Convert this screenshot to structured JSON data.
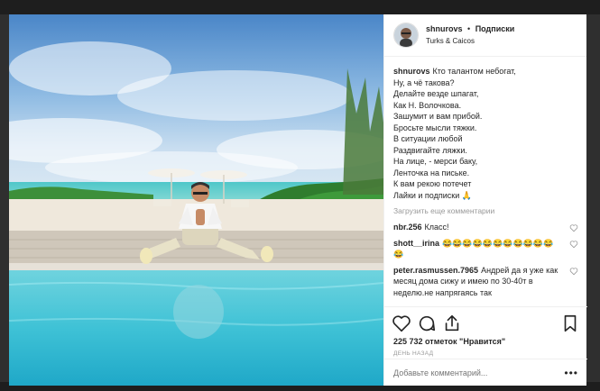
{
  "post": {
    "username": "shnurovs",
    "separator": "•",
    "follow_label": "Подписки",
    "location": "Turks & Caicos"
  },
  "caption": {
    "username": "shnurovs",
    "lines": [
      "Кто талантом небогат,",
      "Ну, а чё такова?",
      "Делайте везде шпагат,",
      "Как Н. Волочкова.",
      "Зашумит и вам прибой.",
      "Бросьте мысли тяжки.",
      "В ситуации любой",
      "Раздвигайте ляжки.",
      "На лице, - мерси баку,",
      "Ленточка на письке.",
      "К вам рекою потечет",
      "Лайки и подписки 🙏"
    ]
  },
  "load_more_label": "Загрузить еще комментарии",
  "comments": [
    {
      "username": "nbr.256",
      "text": "Класс!"
    },
    {
      "username": "shott__irina",
      "text": "😂😂😂😂😂😂😂😂😂😂😂😂"
    },
    {
      "username": "peter.rasmussen.7965",
      "text": "Андрей да я уже как месяц дома сижу и имею по 30-40т в неделю.не напрягаясь так"
    }
  ],
  "likes_text": "225 732 отметок \"Нравится\"",
  "time_ago": "ДЕНЬ НАЗАД",
  "add_comment_placeholder": "Добавьте комментарий...",
  "more_label": "•••",
  "icons": {
    "like": "heart-icon",
    "comment": "comment-icon",
    "share": "share-icon",
    "save": "bookmark-icon",
    "comment_like": "heart-outline-icon"
  },
  "colors": {
    "text": "#262626",
    "muted": "#999999",
    "border": "#efefef"
  }
}
